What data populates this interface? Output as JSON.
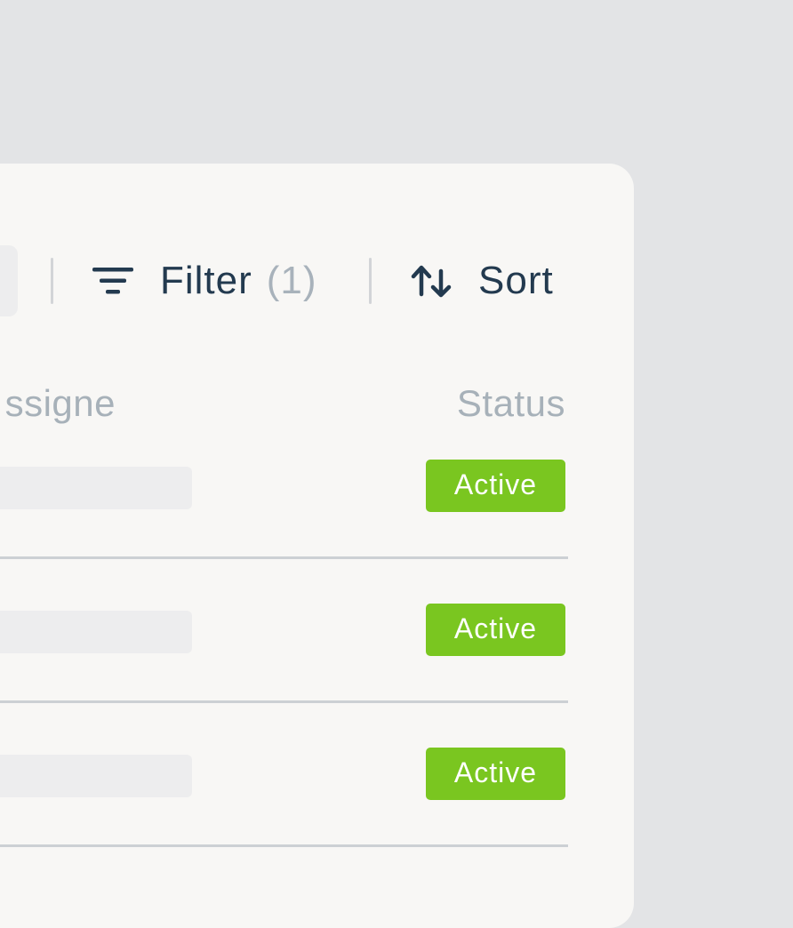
{
  "toolbar": {
    "filter_label": "Filter",
    "filter_count": "(1)",
    "sort_label": "Sort",
    "filter_icon": "filter-icon",
    "sort_icon": "sort-arrows-icon"
  },
  "table": {
    "columns": [
      "ssigne",
      "Status"
    ],
    "rows": [
      {
        "status": "Active"
      },
      {
        "status": "Active"
      },
      {
        "status": "Active"
      }
    ]
  },
  "colors": {
    "background": "#e3e4e6",
    "panel": "#f8f7f5",
    "text_primary": "#233a4f",
    "text_muted": "#a8b2bb",
    "badge_active": "#7ac620",
    "divider": "#ccd0d4"
  }
}
